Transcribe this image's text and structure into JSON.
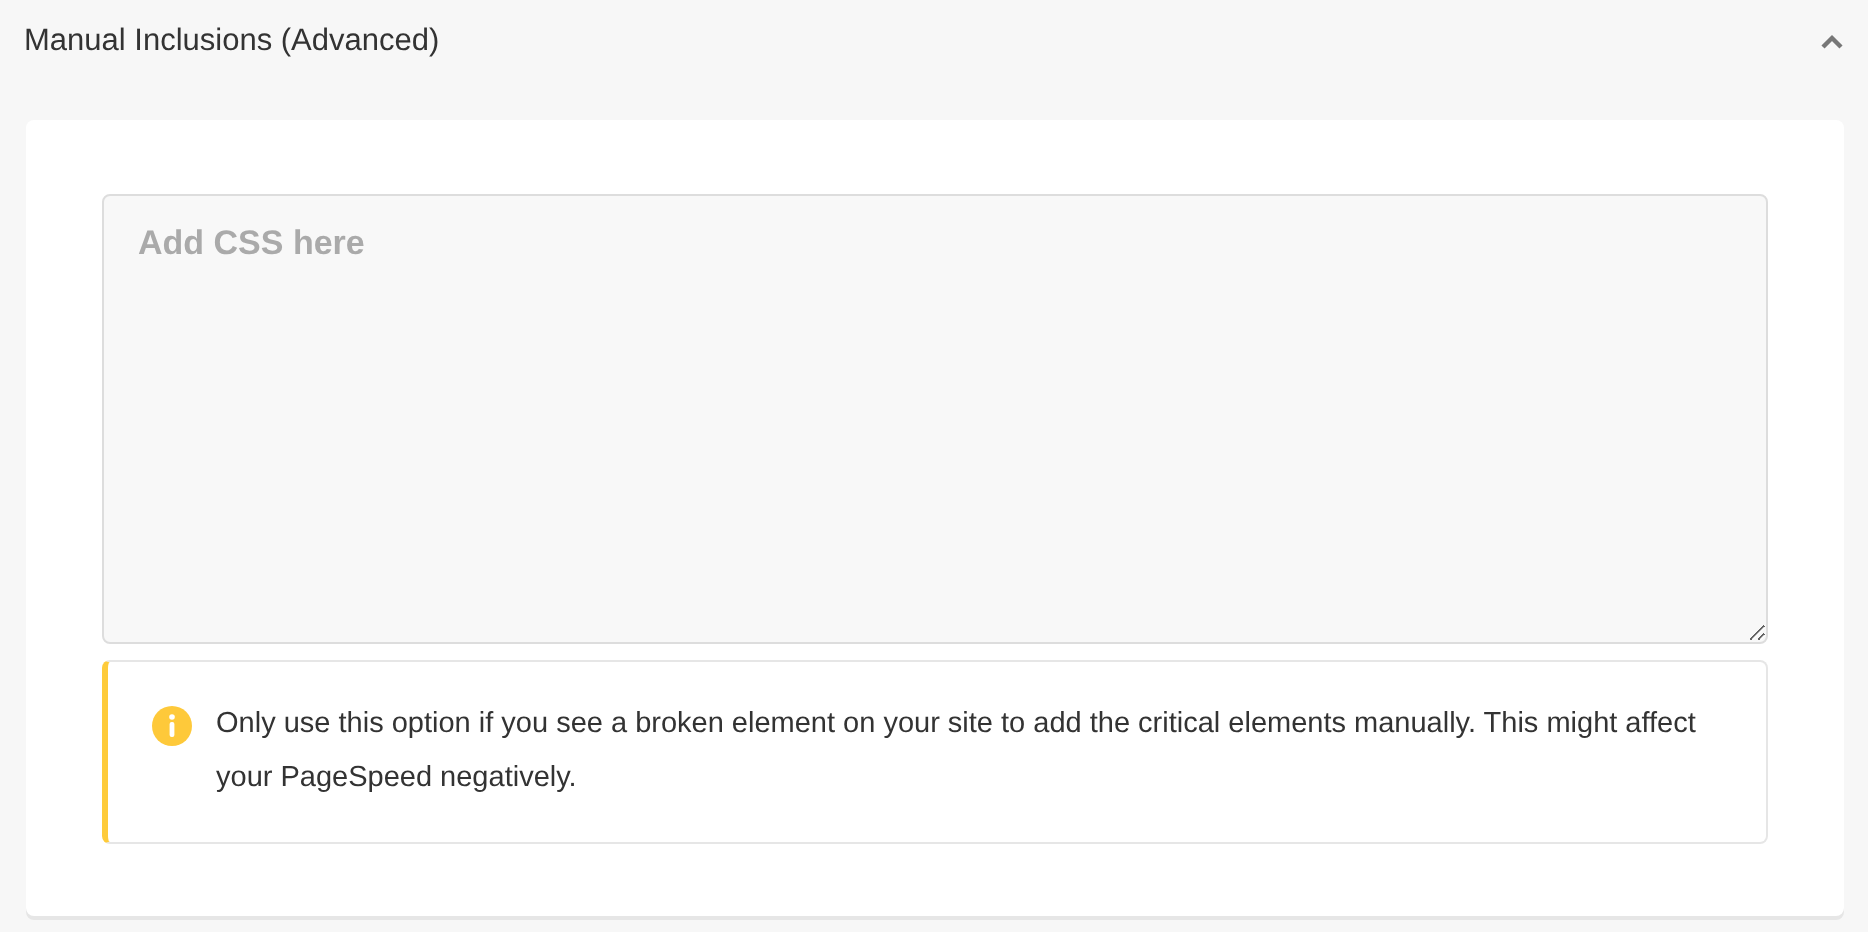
{
  "section": {
    "title": "Manual Inclusions (Advanced)",
    "expanded": true,
    "editor": {
      "placeholder": "Add CSS here"
    },
    "notice": {
      "text": "Only use this option if you see a broken element on your site to add the critical elements manually. This might affect your PageSpeed negatively."
    }
  }
}
